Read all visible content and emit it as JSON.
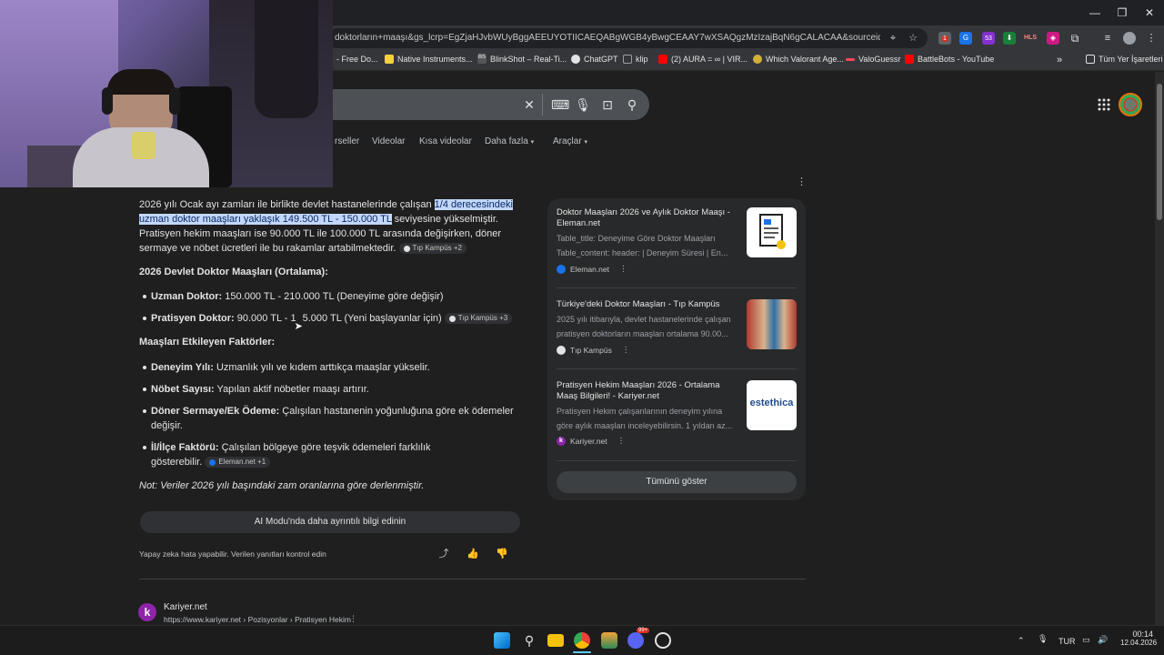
{
  "browser": {
    "url": "doktorların+maaşı&gs_lcrp=EgZjaHJvbWUyBggAEEUYOTIICAEQABgWGB4yBwgCEAAY7wXSAQgzMzIzajBqN6gCALACAA&sourceid=chrome&ie=...",
    "bookmarks": [
      {
        "label": "- Free Do...",
        "color": "#e8710a"
      },
      {
        "label": "Native Instruments...",
        "color": "#f4d03f"
      },
      {
        "label": "BlinkShot – Real-Ti...",
        "color": "#555555"
      },
      {
        "label": "ChatGPT",
        "color": "#e3e3e3"
      },
      {
        "label": "klip",
        "color": "#9aa0a6"
      },
      {
        "label": "(2) AURA = ∞ | VIR...",
        "color": "#ff0000"
      },
      {
        "label": "Which Valorant Age...",
        "color": "#d4af37"
      },
      {
        "label": "ValoGuessr",
        "color": "#ff4655"
      },
      {
        "label": "BattleBots - YouTube",
        "color": "#ff0000"
      }
    ],
    "bookmarks_more": "»",
    "all_bookmarks": "Tüm Yer İşaretleri",
    "bs_label": "BS",
    "ext_badge_red": "1",
    "ext_badge_blue": "53",
    "ext_his": "HLS"
  },
  "search": {
    "tabs": [
      "rseller",
      "Videolar",
      "Kısa videolar",
      "Daha fazla",
      "Araçlar"
    ]
  },
  "ai_overview": {
    "para1_pre": "2026 yılı Ocak ayı zamları ile birlikte devlet hastanelerinde çalışan ",
    "para1_hl1": "1/4 derecesindeki",
    "para1_hl2": "uzman doktor maaşları yaklaşık 149.500 TL - 150.000 TL",
    "para1_post": " seviyesine yükselmiştir.",
    "para1_line3": "Pratisyen hekim maaşları ise 90.000 TL ile 100.000 TL arasında değişirken, döner",
    "para1_line4": "sermaye ve nöbet ücretleri ile bu rakamlar artabilmektedir.",
    "para1_chip": "Tıp Kampüs +2",
    "h_salaries": "2026 Devlet Doktor Maaşları (Ortalama):",
    "b1_label": "Uzman Doktor:",
    "b1_text": " 150.000 TL - 210.000 TL (Deneyime göre değişir)",
    "b2_label": "Pratisyen Doktor:",
    "b2_text": " 90.000 TL - 1",
    "b2_text2": "5.000 TL (Yeni başlayanlar için)",
    "b2_chip": "Tıp Kampüs +3",
    "h_factors": "Maaşları Etkileyen Faktörler:",
    "f1_label": "Deneyim Yılı:",
    "f1_text": " Uzmanlık yılı ve kıdem arttıkça maaşlar yükselir.",
    "f2_label": "Nöbet Sayısı:",
    "f2_text": " Yapılan aktif nöbetler maaşı artırır.",
    "f3_label": "Döner Sermaye/Ek Ödeme:",
    "f3_text": " Çalışılan hastanenin yoğunluğuna göre ek ödemeler",
    "f3_text2": "değişir.",
    "f4_label": "İl/İlçe Faktörü:",
    "f4_text": " Çalışılan bölgeye göre teşvik ödemeleri farklılık",
    "f4_text2": "gösterebilir.",
    "f4_chip": "Eleman.net +1",
    "note": "Not: Veriler 2026 yılı başındaki zam oranlarına göre derlenmiştir.",
    "more_button": "AI Modu'nda daha ayrıntılı bilgi edinin",
    "disclaimer": "Yapay zeka hata yapabilir. Verilen yanıtları kontrol edin"
  },
  "sources": [
    {
      "title": "Doktor Maaşları 2026 ve Aylık Doktor Maaşı - Eleman.net",
      "snippet1": "Table_title: Deneyime Göre Doktor Maaşları",
      "snippet2": "Table_content: header: | Deneyim Süresi | En...",
      "site": "Eleman.net"
    },
    {
      "title": "Türkiye'deki Doktor Maaşları - Tıp Kampüs",
      "snippet1": "2025 yılı itibarıyla, devlet hastanelerinde çalışan",
      "snippet2": "pratisyen doktorların maaşları ortalama 90.00...",
      "site": "Tıp Kampüs"
    },
    {
      "title": "Pratisyen Hekim Maaşları 2026 - Ortalama Maaş Bilgileri! - Kariyer.net",
      "snippet1": "Pratisyen Hekim çalışanlarının deneyim yılına",
      "snippet2": "göre aylık maaşları inceleyebilirsin. 1 yıldan az...",
      "site": "Kariyer.net",
      "thumb_text": "estethica"
    }
  ],
  "show_all": "Tümünü göster",
  "result": {
    "site": "Kariyer.net",
    "letter": "k",
    "path": "https://www.kariyer.net › Pozisyonlar › Pratisyen Hekim"
  },
  "taskbar": {
    "lang": "TUR",
    "time": "00:14",
    "date": "12.04.2026",
    "badge": "99+"
  }
}
